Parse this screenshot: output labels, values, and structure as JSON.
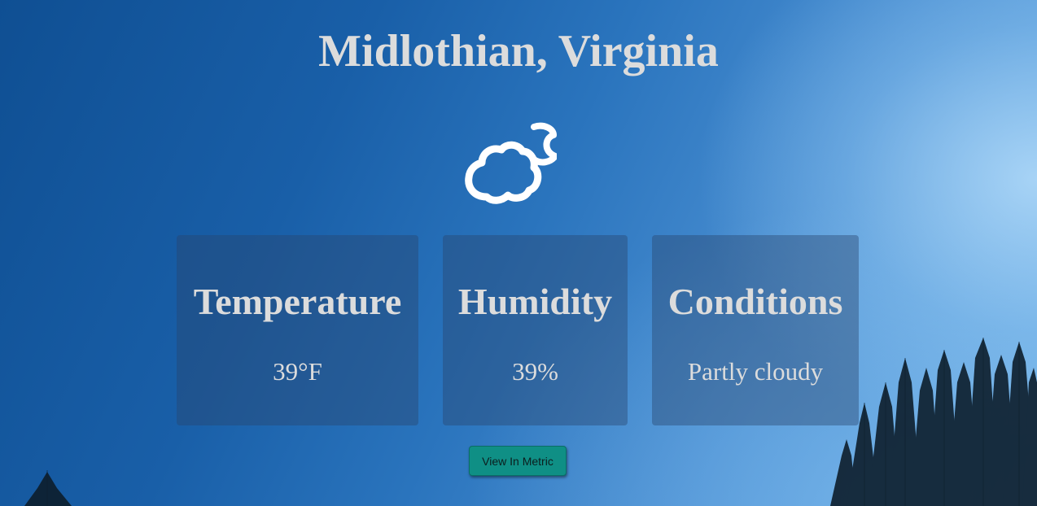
{
  "location": {
    "title": "Midlothian, Virginia"
  },
  "weather_icon": {
    "name": "partly-cloudy-night-icon",
    "color": "#ffffff"
  },
  "cards": {
    "temperature": {
      "label": "Temperature",
      "value": "39°F"
    },
    "humidity": {
      "label": "Humidity",
      "value": "39%"
    },
    "conditions": {
      "label": "Conditions",
      "value": "Partly cloudy"
    }
  },
  "actions": {
    "metric_button_label": "View In Metric"
  },
  "colors": {
    "sky_dark": "#0f4f93",
    "sky_light": "#8cc3f0",
    "text": "#dcdcdc",
    "card_background": "rgba(40,70,110,0.42)",
    "button": "#0f8f85"
  }
}
